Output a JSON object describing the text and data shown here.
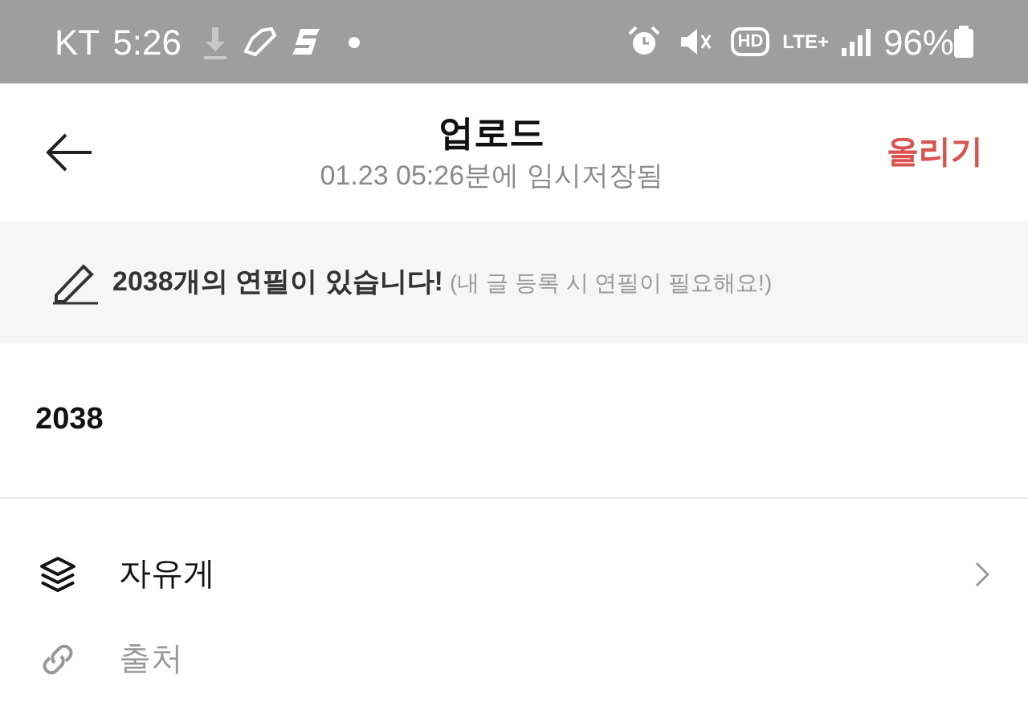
{
  "status_bar": {
    "carrier": "KT",
    "time": "5:26",
    "call_quality": "HD",
    "network": "LTE+",
    "battery": "96%"
  },
  "header": {
    "title": "업로드",
    "subtitle": "01.23 05:26분에 임시저장됨",
    "action": "올리기"
  },
  "notice": {
    "text": "2038개의 연필이 있습니다!",
    "hint": "(내 글 등록 시 연필이 필요해요!)"
  },
  "title_field": {
    "value": "2038"
  },
  "rows": [
    {
      "kind": "board",
      "value": "자유게"
    },
    {
      "kind": "source",
      "placeholder": "출처"
    }
  ]
}
